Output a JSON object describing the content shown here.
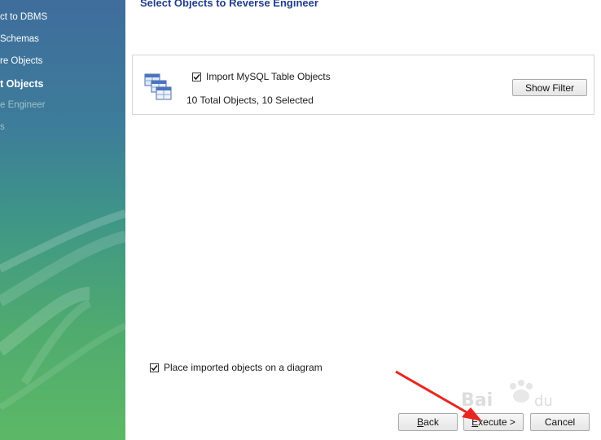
{
  "sidebar": {
    "steps": [
      {
        "label": "ct to DBMS",
        "state": "done"
      },
      {
        "label": "Schemas",
        "state": "done"
      },
      {
        "label": "re Objects",
        "state": "done"
      },
      {
        "label": "t Objects",
        "state": "current"
      },
      {
        "label": "e Engineer",
        "state": "future"
      },
      {
        "label": "s",
        "state": "future"
      }
    ]
  },
  "main": {
    "title": "Select Objects to Reverse Engineer",
    "objects_panel": {
      "import_label": "Import MySQL Table Objects",
      "import_checked": true,
      "summary": "10 Total Objects, 10 Selected",
      "show_filter_label": "Show Filter",
      "icon": "table-objects-icon"
    },
    "place_on_diagram": {
      "label": "Place imported objects on a diagram",
      "checked": true
    }
  },
  "footer": {
    "back": {
      "mnemonic": "B",
      "rest": "ack"
    },
    "execute": {
      "mnemonic": "E",
      "rest": "xecute >"
    },
    "cancel_label": "Cancel"
  },
  "colors": {
    "title": "#1f3d8a",
    "annotation_arrow": "#e8261f",
    "sidebar_top": "#3f6d9c",
    "sidebar_bottom": "#5db866"
  }
}
